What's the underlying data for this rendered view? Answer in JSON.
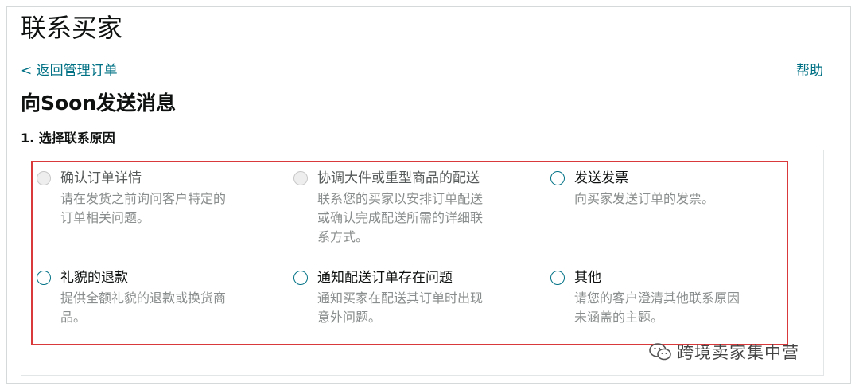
{
  "page": {
    "title": "联系买家",
    "back_link": "< 返回管理订单",
    "help_link": "帮助",
    "subtitle": "向Soon发送消息",
    "step_label": "1. 选择联系原因"
  },
  "options": [
    {
      "title": "确认订单详情",
      "desc": "请在发货之前询问客户特定的\n订单相关问题。",
      "enabled": false
    },
    {
      "title": "协调大件或重型商品的配送",
      "desc": "联系您的买家以安排订单配送\n或确认完成配送所需的详细联\n系方式。",
      "enabled": false
    },
    {
      "title": "发送发票",
      "desc": "向买家发送订单的发票。",
      "enabled": true
    },
    {
      "title": "礼貌的退款",
      "desc": "提供全额礼貌的退款或换货商\n品。",
      "enabled": true
    },
    {
      "title": "通知配送订单存在问题",
      "desc": "通知买家在配送其订单时出现\n意外问题。",
      "enabled": true
    },
    {
      "title": "其他",
      "desc": "请您的客户澄清其他联系原因\n未涵盖的主题。",
      "enabled": true
    }
  ],
  "watermark": {
    "text": "跨境卖家集中营",
    "icon": "wechat-icon"
  },
  "colors": {
    "link": "#007185",
    "highlight": "#d9393b",
    "muted": "#8a8d8d"
  }
}
